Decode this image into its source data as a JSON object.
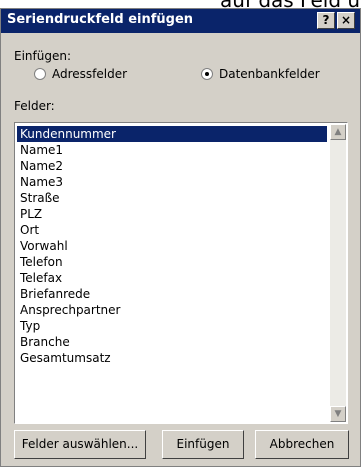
{
  "background_text": "auf das Feld und anschließ",
  "dialog": {
    "title": "Seriendruckfeld einfügen",
    "help_label": "?",
    "close_label": "×",
    "insert_group_label": "Einfügen:",
    "radio_address": "Adressfelder",
    "radio_database": "Datenbankfelder",
    "selected_radio": "Datenbankfelder",
    "fields_label": "Felder:",
    "fields": [
      "Kundennummer",
      "Name1",
      "Name2",
      "Name3",
      "Straße",
      "PLZ",
      "Ort",
      "Vorwahl",
      "Telefon",
      "Telefax",
      "Briefanrede",
      "Ansprechpartner",
      "Typ",
      "Branche",
      "Gesamtumsatz"
    ],
    "selected_field": "Kundennummer",
    "buttons": {
      "select_fields": "Felder auswählen...",
      "insert": "Einfügen",
      "cancel": "Abbrechen"
    }
  }
}
